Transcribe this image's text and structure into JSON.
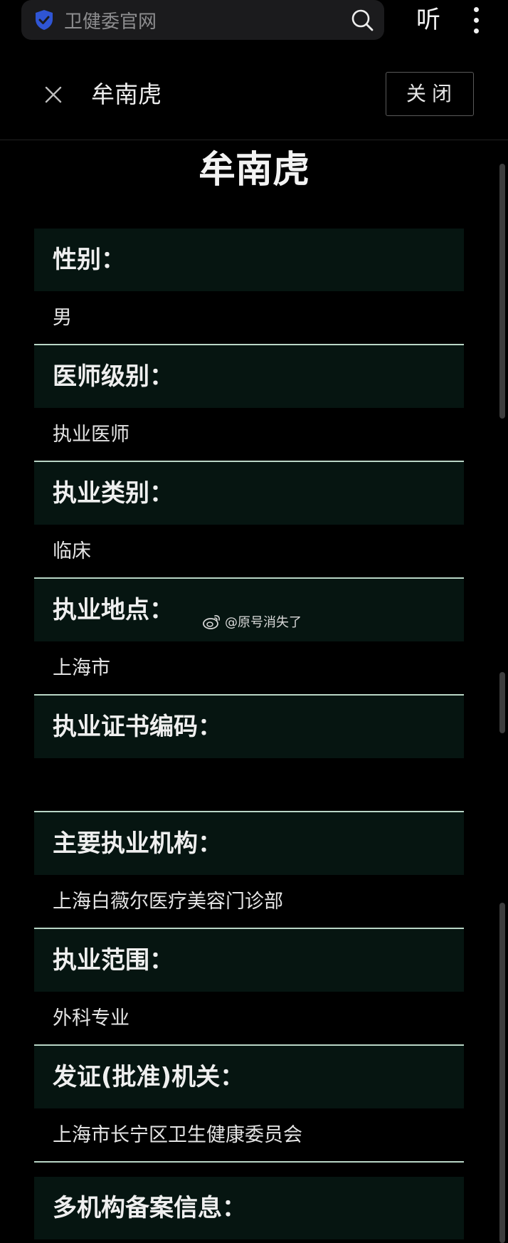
{
  "browser": {
    "url_text": "卫健委官网",
    "listen_label": "听",
    "icons": [
      "shield-icon",
      "search-icon",
      "more-vert-icon"
    ]
  },
  "panel": {
    "header_title": "牟南虎",
    "close_button": "关闭",
    "close_icon": "close-icon"
  },
  "doc": {
    "title": "牟南虎",
    "rows": [
      {
        "label": "性别：",
        "value": "男"
      },
      {
        "label": "医师级别：",
        "value": "执业医师"
      },
      {
        "label": "执业类别：",
        "value": "临床"
      },
      {
        "label": "执业地点：",
        "value": "上海市"
      },
      {
        "label": "执业证书编码：",
        "value": ""
      },
      {
        "label": "主要执业机构：",
        "value": "上海白薇尔医疗美容门诊部"
      },
      {
        "label": "执业范围：",
        "value": "外科专业"
      },
      {
        "label": "发证(批准)机关：",
        "value": "上海市长宁区卫生健康委员会"
      },
      {
        "label": "多机构备案信息：",
        "value": ""
      }
    ]
  },
  "watermark": {
    "text": "@原号消失了",
    "icon": "weibo-icon"
  },
  "colors": {
    "background": "#000000",
    "label_bg": "#061511",
    "divider": "#b9d6c6",
    "urlbar_bg": "#1b1b1d",
    "shield": "#2f55d4"
  }
}
